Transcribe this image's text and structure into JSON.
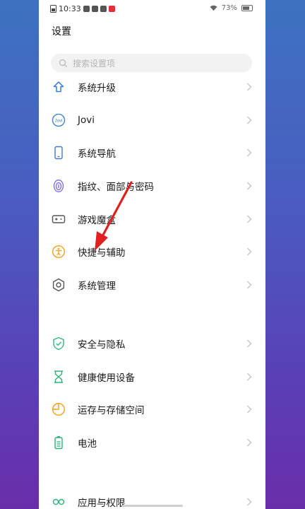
{
  "status_bar": {
    "time": "10:33",
    "battery": "73%"
  },
  "header": {
    "title": "设置"
  },
  "search": {
    "placeholder": "搜索设置项"
  },
  "items": [
    {
      "label": "系统升级",
      "icon": "upgrade-icon"
    },
    {
      "label": "Jovi",
      "icon": "jovi-icon"
    },
    {
      "label": "系统导航",
      "icon": "phone-icon"
    },
    {
      "label": "指纹、面部与密码",
      "icon": "fingerprint-icon"
    },
    {
      "label": "游戏魔盒",
      "icon": "gamepad-icon"
    },
    {
      "label": "快捷与辅助",
      "icon": "accessibility-icon"
    },
    {
      "label": "系统管理",
      "icon": "gear-icon"
    },
    {
      "label": "安全与隐私",
      "icon": "shield-icon"
    },
    {
      "label": "健康使用设备",
      "icon": "hourglass-icon"
    },
    {
      "label": "运存与存储空间",
      "icon": "storage-icon"
    },
    {
      "label": "电池",
      "icon": "battery-icon"
    },
    {
      "label": "应用与权限",
      "icon": "apps-icon"
    }
  ],
  "colors": {
    "accent_blue": "#3a7bd5",
    "accent_green": "#2fb37a",
    "accent_orange": "#f0a020",
    "arrow_red": "#e02020"
  }
}
